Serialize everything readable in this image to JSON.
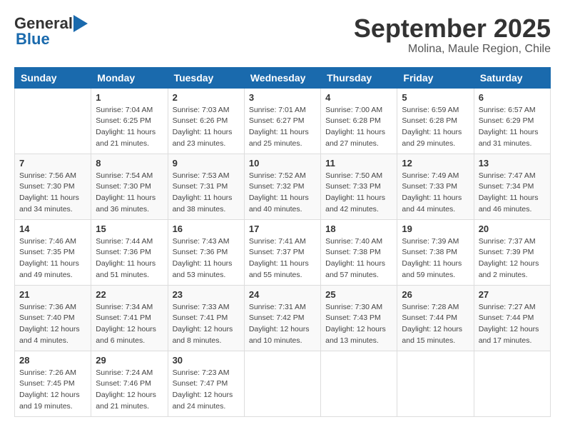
{
  "logo": {
    "general": "General",
    "blue": "Blue"
  },
  "title": "September 2025",
  "location": "Molina, Maule Region, Chile",
  "days_of_week": [
    "Sunday",
    "Monday",
    "Tuesday",
    "Wednesday",
    "Thursday",
    "Friday",
    "Saturday"
  ],
  "weeks": [
    [
      {
        "day": "",
        "info": ""
      },
      {
        "day": "1",
        "info": "Sunrise: 7:04 AM\nSunset: 6:25 PM\nDaylight: 11 hours\nand 21 minutes."
      },
      {
        "day": "2",
        "info": "Sunrise: 7:03 AM\nSunset: 6:26 PM\nDaylight: 11 hours\nand 23 minutes."
      },
      {
        "day": "3",
        "info": "Sunrise: 7:01 AM\nSunset: 6:27 PM\nDaylight: 11 hours\nand 25 minutes."
      },
      {
        "day": "4",
        "info": "Sunrise: 7:00 AM\nSunset: 6:28 PM\nDaylight: 11 hours\nand 27 minutes."
      },
      {
        "day": "5",
        "info": "Sunrise: 6:59 AM\nSunset: 6:28 PM\nDaylight: 11 hours\nand 29 minutes."
      },
      {
        "day": "6",
        "info": "Sunrise: 6:57 AM\nSunset: 6:29 PM\nDaylight: 11 hours\nand 31 minutes."
      }
    ],
    [
      {
        "day": "7",
        "info": "Sunrise: 7:56 AM\nSunset: 7:30 PM\nDaylight: 11 hours\nand 34 minutes."
      },
      {
        "day": "8",
        "info": "Sunrise: 7:54 AM\nSunset: 7:30 PM\nDaylight: 11 hours\nand 36 minutes."
      },
      {
        "day": "9",
        "info": "Sunrise: 7:53 AM\nSunset: 7:31 PM\nDaylight: 11 hours\nand 38 minutes."
      },
      {
        "day": "10",
        "info": "Sunrise: 7:52 AM\nSunset: 7:32 PM\nDaylight: 11 hours\nand 40 minutes."
      },
      {
        "day": "11",
        "info": "Sunrise: 7:50 AM\nSunset: 7:33 PM\nDaylight: 11 hours\nand 42 minutes."
      },
      {
        "day": "12",
        "info": "Sunrise: 7:49 AM\nSunset: 7:33 PM\nDaylight: 11 hours\nand 44 minutes."
      },
      {
        "day": "13",
        "info": "Sunrise: 7:47 AM\nSunset: 7:34 PM\nDaylight: 11 hours\nand 46 minutes."
      }
    ],
    [
      {
        "day": "14",
        "info": "Sunrise: 7:46 AM\nSunset: 7:35 PM\nDaylight: 11 hours\nand 49 minutes."
      },
      {
        "day": "15",
        "info": "Sunrise: 7:44 AM\nSunset: 7:36 PM\nDaylight: 11 hours\nand 51 minutes."
      },
      {
        "day": "16",
        "info": "Sunrise: 7:43 AM\nSunset: 7:36 PM\nDaylight: 11 hours\nand 53 minutes."
      },
      {
        "day": "17",
        "info": "Sunrise: 7:41 AM\nSunset: 7:37 PM\nDaylight: 11 hours\nand 55 minutes."
      },
      {
        "day": "18",
        "info": "Sunrise: 7:40 AM\nSunset: 7:38 PM\nDaylight: 11 hours\nand 57 minutes."
      },
      {
        "day": "19",
        "info": "Sunrise: 7:39 AM\nSunset: 7:38 PM\nDaylight: 11 hours\nand 59 minutes."
      },
      {
        "day": "20",
        "info": "Sunrise: 7:37 AM\nSunset: 7:39 PM\nDaylight: 12 hours\nand 2 minutes."
      }
    ],
    [
      {
        "day": "21",
        "info": "Sunrise: 7:36 AM\nSunset: 7:40 PM\nDaylight: 12 hours\nand 4 minutes."
      },
      {
        "day": "22",
        "info": "Sunrise: 7:34 AM\nSunset: 7:41 PM\nDaylight: 12 hours\nand 6 minutes."
      },
      {
        "day": "23",
        "info": "Sunrise: 7:33 AM\nSunset: 7:41 PM\nDaylight: 12 hours\nand 8 minutes."
      },
      {
        "day": "24",
        "info": "Sunrise: 7:31 AM\nSunset: 7:42 PM\nDaylight: 12 hours\nand 10 minutes."
      },
      {
        "day": "25",
        "info": "Sunrise: 7:30 AM\nSunset: 7:43 PM\nDaylight: 12 hours\nand 13 minutes."
      },
      {
        "day": "26",
        "info": "Sunrise: 7:28 AM\nSunset: 7:44 PM\nDaylight: 12 hours\nand 15 minutes."
      },
      {
        "day": "27",
        "info": "Sunrise: 7:27 AM\nSunset: 7:44 PM\nDaylight: 12 hours\nand 17 minutes."
      }
    ],
    [
      {
        "day": "28",
        "info": "Sunrise: 7:26 AM\nSunset: 7:45 PM\nDaylight: 12 hours\nand 19 minutes."
      },
      {
        "day": "29",
        "info": "Sunrise: 7:24 AM\nSunset: 7:46 PM\nDaylight: 12 hours\nand 21 minutes."
      },
      {
        "day": "30",
        "info": "Sunrise: 7:23 AM\nSunset: 7:47 PM\nDaylight: 12 hours\nand 24 minutes."
      },
      {
        "day": "",
        "info": ""
      },
      {
        "day": "",
        "info": ""
      },
      {
        "day": "",
        "info": ""
      },
      {
        "day": "",
        "info": ""
      }
    ]
  ]
}
